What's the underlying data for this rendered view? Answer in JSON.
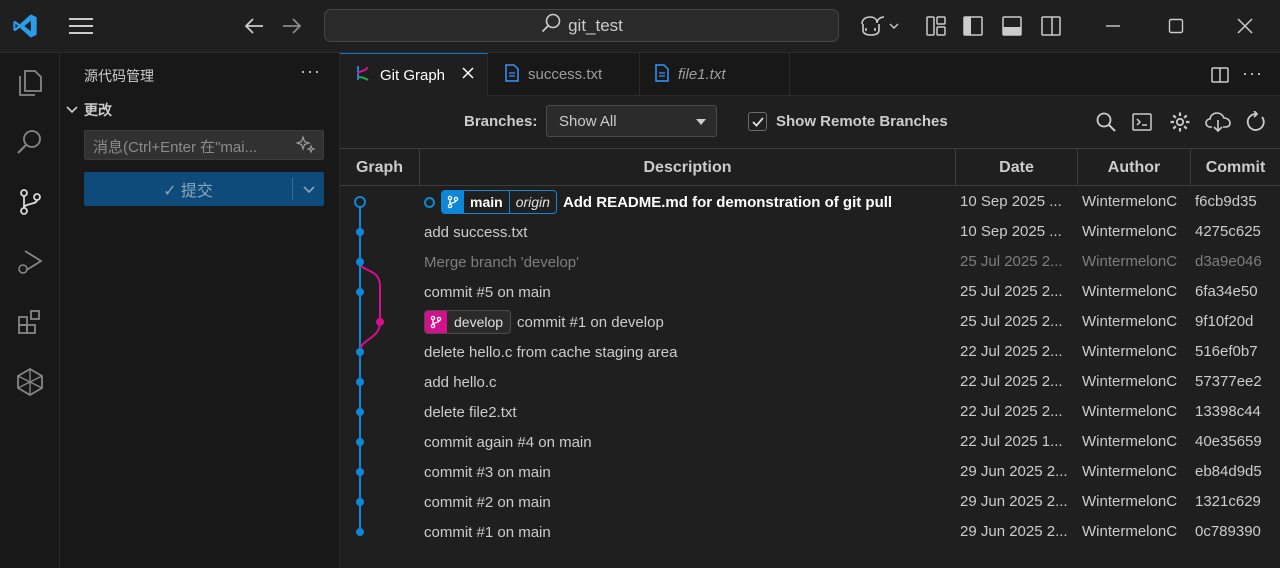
{
  "titlebar": {
    "search_text": "git_test"
  },
  "sidebar": {
    "title": "源代码管理",
    "more": "···",
    "section_label": "更改",
    "message_placeholder": "消息(Ctrl+Enter 在\"mai...",
    "commit_label": "✓ 提交"
  },
  "tabs": [
    {
      "label": "Git Graph",
      "icon": "git-graph-icon",
      "active": true
    },
    {
      "label": "success.txt",
      "icon": "file-icon",
      "active": false
    },
    {
      "label": "file1.txt",
      "icon": "file-icon",
      "active": false,
      "italic": true
    }
  ],
  "controls": {
    "branches_label": "Branches:",
    "branches_value": "Show All",
    "show_remote_label": "Show Remote Branches",
    "show_remote_checked": true
  },
  "table": {
    "headers": [
      "Graph",
      "Description",
      "Date",
      "Author",
      "Commit"
    ],
    "rows": [
      {
        "description": "Add README.md for demonstration of git pull",
        "bold": true,
        "refs": [
          {
            "name": "main",
            "remote": "origin",
            "color": "#0d87d6"
          }
        ],
        "head": true,
        "date": "10 Sep 2025 ...",
        "author": "WintermelonC",
        "commit": "f6cb9d35",
        "lane": 0
      },
      {
        "description": "add success.txt",
        "date": "10 Sep 2025 ...",
        "author": "WintermelonC",
        "commit": "4275c625",
        "lane": 0
      },
      {
        "description": "Merge branch 'develop'",
        "muted": true,
        "date": "25 Jul 2025 2...",
        "author": "WintermelonC",
        "commit": "d3a9e046",
        "lane": 0
      },
      {
        "description": "commit #5 on main",
        "date": "25 Jul 2025 2...",
        "author": "WintermelonC",
        "commit": "6fa34e50",
        "lane": 0
      },
      {
        "description": "commit #1 on develop",
        "refs": [
          {
            "name": "develop",
            "color": "#d4108e"
          }
        ],
        "date": "25 Jul 2025 2...",
        "author": "WintermelonC",
        "commit": "9f10f20d",
        "lane": 1
      },
      {
        "description": "delete hello.c from cache staging area",
        "date": "22 Jul 2025 2...",
        "author": "WintermelonC",
        "commit": "516ef0b7",
        "lane": 0
      },
      {
        "description": "add hello.c",
        "date": "22 Jul 2025 2...",
        "author": "WintermelonC",
        "commit": "57377ee2",
        "lane": 0
      },
      {
        "description": "delete file2.txt",
        "date": "22 Jul 2025 2...",
        "author": "WintermelonC",
        "commit": "13398c44",
        "lane": 0
      },
      {
        "description": "commit again #4 on main",
        "date": "22 Jul 2025 1...",
        "author": "WintermelonC",
        "commit": "40e35659",
        "lane": 0
      },
      {
        "description": "commit #3 on main",
        "date": "29 Jun 2025 2...",
        "author": "WintermelonC",
        "commit": "eb84d9d5",
        "lane": 0
      },
      {
        "description": "commit #2 on main",
        "date": "29 Jun 2025 2...",
        "author": "WintermelonC",
        "commit": "1321c629",
        "lane": 0
      },
      {
        "description": "commit #1 on main",
        "date": "29 Jun 2025 2...",
        "author": "WintermelonC",
        "commit": "0c789390",
        "lane": 0
      }
    ]
  },
  "colors": {
    "accent": "#0078d4",
    "lane_main": "#0d87d6",
    "lane_develop": "#d4108e"
  }
}
